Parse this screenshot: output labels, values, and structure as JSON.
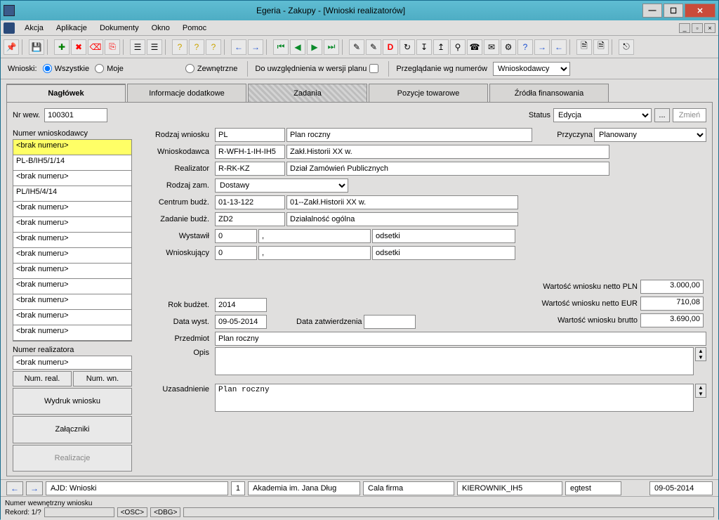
{
  "window": {
    "title": "Egeria - Zakupy - [Wnioski realizatorów]"
  },
  "menu": {
    "akcja": "Akcja",
    "aplikacje": "Aplikacje",
    "dokumenty": "Dokumenty",
    "okno": "Okno",
    "pomoc": "Pomoc"
  },
  "filter": {
    "wnioski": "Wnioski:",
    "wszystkie": "Wszystkie",
    "moje": "Moje",
    "zewnetrzne": "Zewnętrzne",
    "uwzgl": "Do uwzględnienia w wersji planu",
    "przegl": "Przeglądanie wg numerów",
    "przegl_val": "Wnioskodawcy"
  },
  "tabs": {
    "naglowek": "Nagłówek",
    "info": "Informacje dodatkowe",
    "zadania": "Zadania",
    "pozycje": "Pozycje towarowe",
    "zrodla": "Źródła finansowania"
  },
  "left": {
    "nrwew_lbl": "Nr wew.",
    "nrwew": "100301",
    "numerwn": "Numer wnioskodawcy",
    "items": [
      "<brak numeru>",
      "PL-B/IH5/1/14",
      "<brak numeru>",
      "PL/IH5/4/14",
      "<brak numeru>",
      "<brak numeru>",
      "<brak numeru>",
      "<brak numeru>",
      "<brak numeru>",
      "<brak numeru>",
      "<brak numeru>",
      "<brak numeru>",
      "<brak numeru>"
    ],
    "numreal_lbl": "Numer realizatora",
    "numreal": "<brak numeru>",
    "btn_numreal": "Num. real.",
    "btn_numwn": "Num. wn.",
    "btn_wydruk": "Wydruk wniosku",
    "btn_zal": "Załączniki",
    "btn_realiz": "Realizacje"
  },
  "form": {
    "status_lbl": "Status",
    "status": "Edycja",
    "zmien": "Zmień",
    "rodzaj_lbl": "Rodzaj wniosku",
    "rodzaj_code": "PL",
    "rodzaj_txt": "Plan roczny",
    "przyczyna_lbl": "Przyczyna",
    "przyczyna": "Planowany",
    "wniosk_lbl": "Wnioskodawca",
    "wniosk_code": "R-WFH-1-IH-IH5",
    "wniosk_txt": "Zakł.Historii XX w.",
    "realiz_lbl": "Realizator",
    "realiz_code": "R-RK-KZ",
    "realiz_txt": "Dział Zamówień Publicznych",
    "rodzajzam_lbl": "Rodzaj zam.",
    "rodzajzam": "Dostawy",
    "centrum_lbl": "Centrum budż.",
    "centrum_code": "01-13-122",
    "centrum_txt": "01--Zakł.Historii XX w.",
    "zadanie_lbl": "Zadanie budż.",
    "zadanie_code": "ZD2",
    "zadanie_txt": "Działalność ogólna",
    "wystawil_lbl": "Wystawił",
    "wystawil_a": "0",
    "wystawil_b": ",",
    "wystawil_c": "odsetki",
    "wnioskujacy_lbl": "Wnioskujący",
    "wnioskujacy_a": "0",
    "wnioskujacy_b": ",",
    "wnioskujacy_c": "odsetki",
    "rok_lbl": "Rok budżet.",
    "rok": "2014",
    "datawyst_lbl": "Data wyst.",
    "datawyst": "09-05-2014",
    "datazatw_lbl": "Data zatwierdzenia",
    "datazatw": "",
    "netto_pln_lbl": "Wartość wniosku netto PLN",
    "netto_pln": "3.000,00",
    "netto_eur_lbl": "Wartość wniosku netto EUR",
    "netto_eur": "710,08",
    "brutto_lbl": "Wartość wniosku brutto",
    "brutto": "3.690,00",
    "przedmiot_lbl": "Przedmiot",
    "przedmiot": "Plan roczny",
    "opis_lbl": "Opis",
    "opis": "",
    "uzas_lbl": "Uzasadnienie",
    "uzas": "Plan roczny"
  },
  "nav": {
    "a": "AJD: Wnioski",
    "b": "1",
    "c": "Akademia im. Jana Dług",
    "d": "Cala firma",
    "e": "KIEROWNIK_IH5",
    "f": "egtest",
    "g": "09-05-2014"
  },
  "status": {
    "s1": "Numer wewnętrzny wniosku",
    "s2": "Rekord: 1/?",
    "osc": "<OSC>",
    "dbg": "<DBG>"
  }
}
